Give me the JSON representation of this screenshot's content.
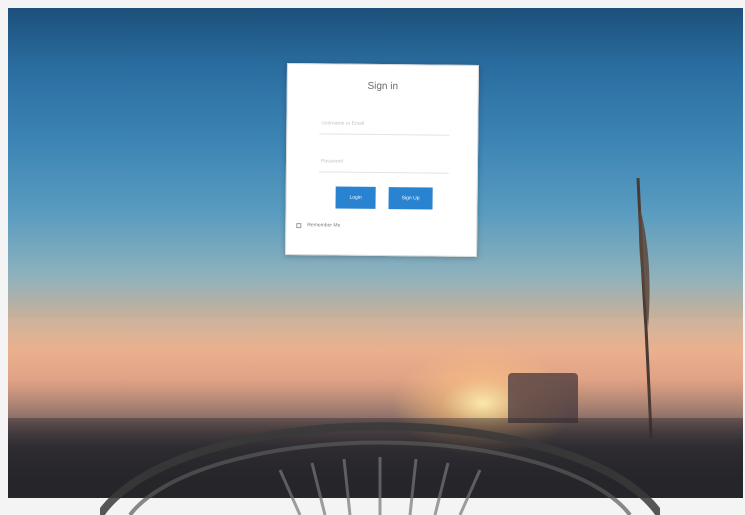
{
  "signin": {
    "title": "Sign in",
    "username_placeholder": "Username or Email",
    "password_placeholder": "Password",
    "login_label": "Login",
    "signup_label": "Sign Up",
    "remember_label": "Remember Me"
  },
  "colors": {
    "button": "#2a83d1",
    "card": "#ffffff"
  }
}
